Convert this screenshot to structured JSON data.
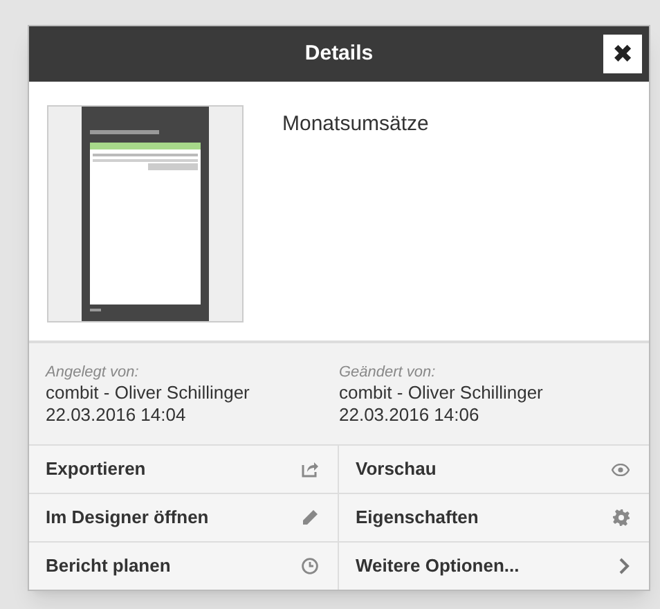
{
  "dialog": {
    "title": "Details",
    "close_label": "✖"
  },
  "report": {
    "name": "Monatsumsätze"
  },
  "info": [
    {
      "label": "Angelegt von:",
      "user": "combit - Oliver Schillinger",
      "date": "22.03.2016 14:04"
    },
    {
      "label": "Geändert von:",
      "user": "combit - Oliver Schillinger",
      "date": "22.03.2016 14:06"
    }
  ],
  "actions": [
    {
      "label": "Exportieren",
      "kind": "export"
    },
    {
      "label": "Vorschau",
      "kind": "preview"
    },
    {
      "label": "Im Designer öffnen",
      "kind": "edit"
    },
    {
      "label": "Eigenschaften",
      "kind": "settings"
    },
    {
      "label": "Bericht planen",
      "kind": "schedule"
    },
    {
      "label": "Weitere Optionen...",
      "kind": "more"
    }
  ]
}
